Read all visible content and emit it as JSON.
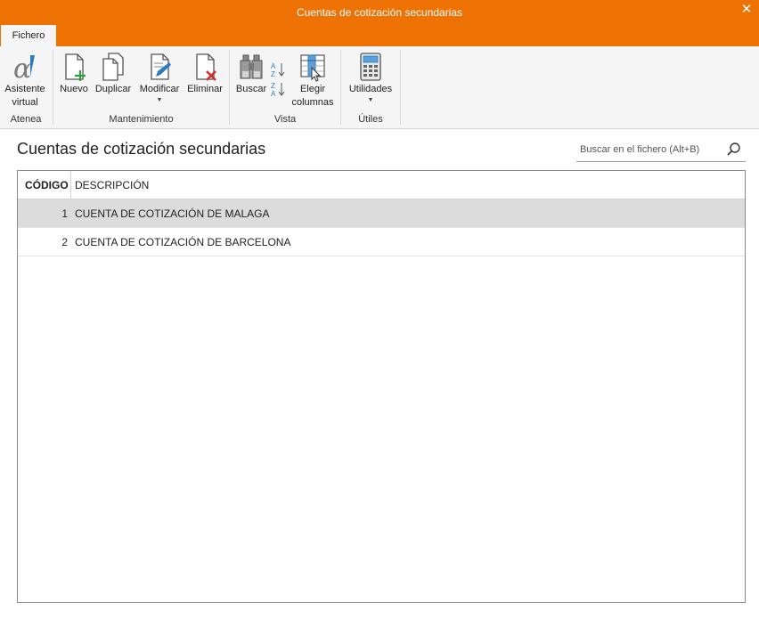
{
  "window": {
    "title": "Cuentas de cotización secundarias",
    "close_glyph": "✕"
  },
  "tabs": [
    {
      "label": "Fichero",
      "active": true
    }
  ],
  "ribbon": {
    "groups": [
      {
        "label": "Atenea",
        "buttons": [
          {
            "label": "Asistente virtual",
            "icon": "alpha-assistant-icon"
          }
        ]
      },
      {
        "label": "Mantenimiento",
        "buttons": [
          {
            "label": "Nuevo",
            "icon": "new-document-icon"
          },
          {
            "label": "Duplicar",
            "icon": "duplicate-icon"
          },
          {
            "label": "Modificar",
            "icon": "edit-document-icon",
            "dropdown": true
          },
          {
            "label": "Eliminar",
            "icon": "delete-document-icon"
          }
        ]
      },
      {
        "label": "Vista",
        "buttons": [
          {
            "label": "Buscar",
            "icon": "binoculars-icon"
          },
          {
            "label": "",
            "icon": "sort-az-icon"
          },
          {
            "label": "Elegir columnas",
            "icon": "choose-columns-icon"
          }
        ]
      },
      {
        "label": "Útiles",
        "buttons": [
          {
            "label": "Utilidades",
            "icon": "calculator-icon",
            "dropdown": true
          }
        ]
      }
    ]
  },
  "main": {
    "title": "Cuentas de cotización secundarias",
    "search": {
      "placeholder": "Buscar en el fichero (Alt+B)",
      "value": ""
    }
  },
  "table": {
    "columns": [
      "CÓDIGO",
      "DESCRIPCIÓN"
    ],
    "rows": [
      {
        "codigo": "1",
        "descripcion": "CUENTA DE COTIZACIÓN DE MALAGA",
        "selected": true
      },
      {
        "codigo": "2",
        "descripcion": "CUENTA DE COTIZACIÓN DE BARCELONA",
        "selected": false
      }
    ]
  },
  "colors": {
    "accent": "#ee7103",
    "ribbon_bg": "#f5f5f5",
    "selected_row": "#dcdcdc",
    "icon_blue": "#2a7bc4",
    "icon_green": "#2e9e3c",
    "icon_red": "#d32f2f"
  }
}
